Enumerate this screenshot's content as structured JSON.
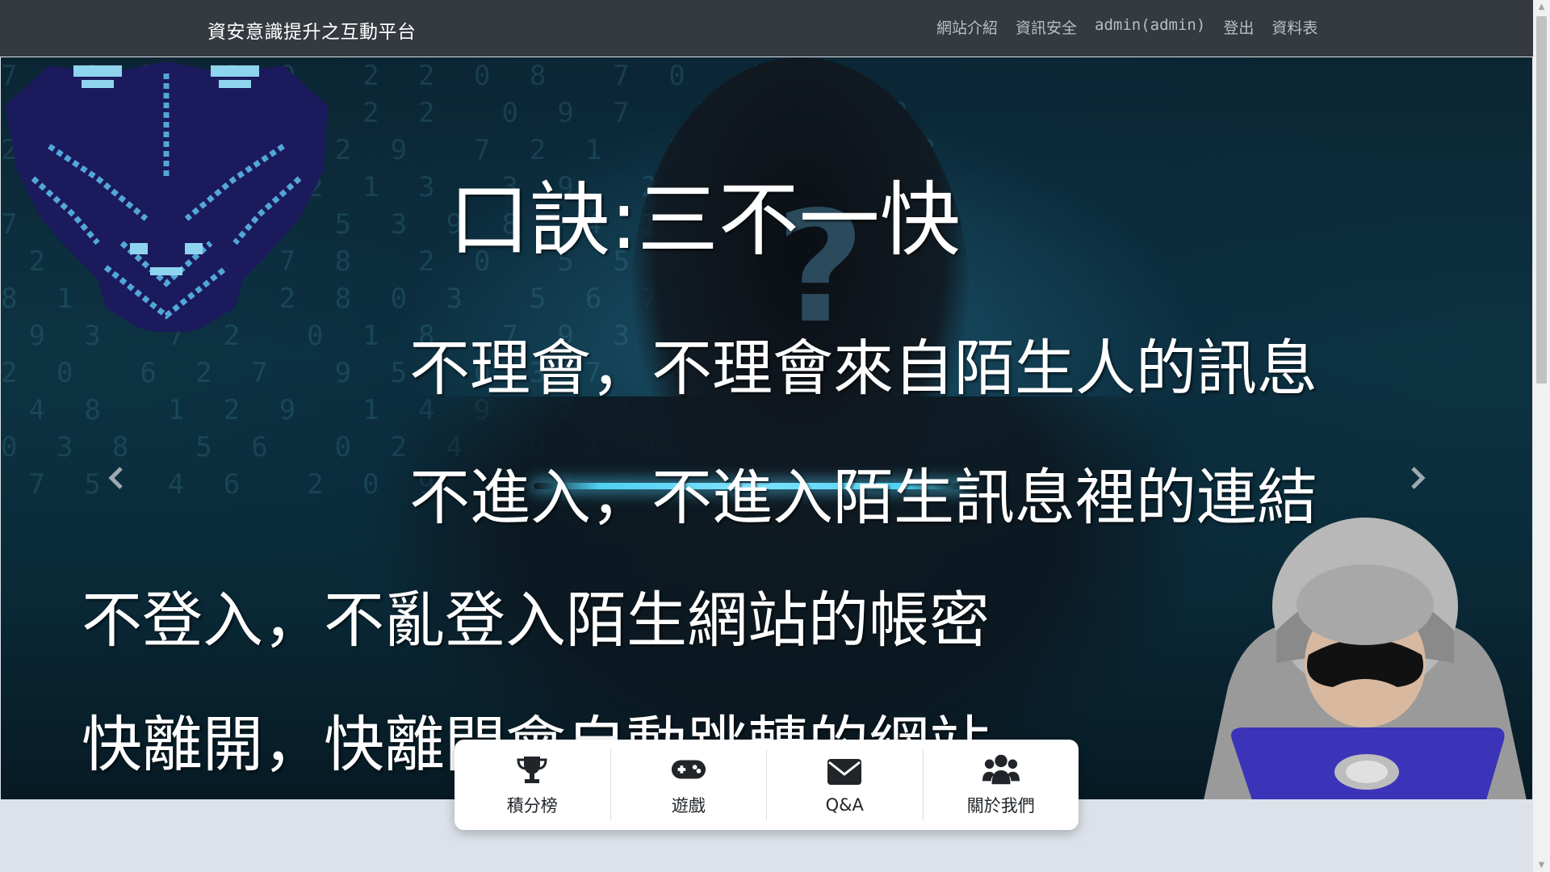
{
  "navbar": {
    "brand": "資安意識提升之互動平台",
    "links": [
      {
        "label": "網站介紹"
      },
      {
        "label": "資訊安全"
      },
      {
        "label": "admin(admin)"
      },
      {
        "label": "登出"
      },
      {
        "label": "資料表"
      }
    ]
  },
  "hero": {
    "title": "口訣:三不一快",
    "lines": [
      "不理會，不理會來自陌生人的訊息",
      "不進入，不進入陌生訊息裡的連結",
      "不登入，不亂登入陌生網站的帳密",
      "快離開，快離開會自動跳轉的網站"
    ],
    "prev_icon": "chevron-left-icon",
    "next_icon": "chevron-right-icon"
  },
  "features": [
    {
      "label": "積分榜",
      "icon": "trophy-icon"
    },
    {
      "label": "遊戲",
      "icon": "gamepad-icon"
    },
    {
      "label": "Q&A",
      "icon": "envelope-icon"
    },
    {
      "label": "關於我們",
      "icon": "users-icon"
    }
  ],
  "colors": {
    "navbar_bg": "#343a40",
    "page_bg": "#dde2ea",
    "nav_link": "#b9bec3"
  }
}
